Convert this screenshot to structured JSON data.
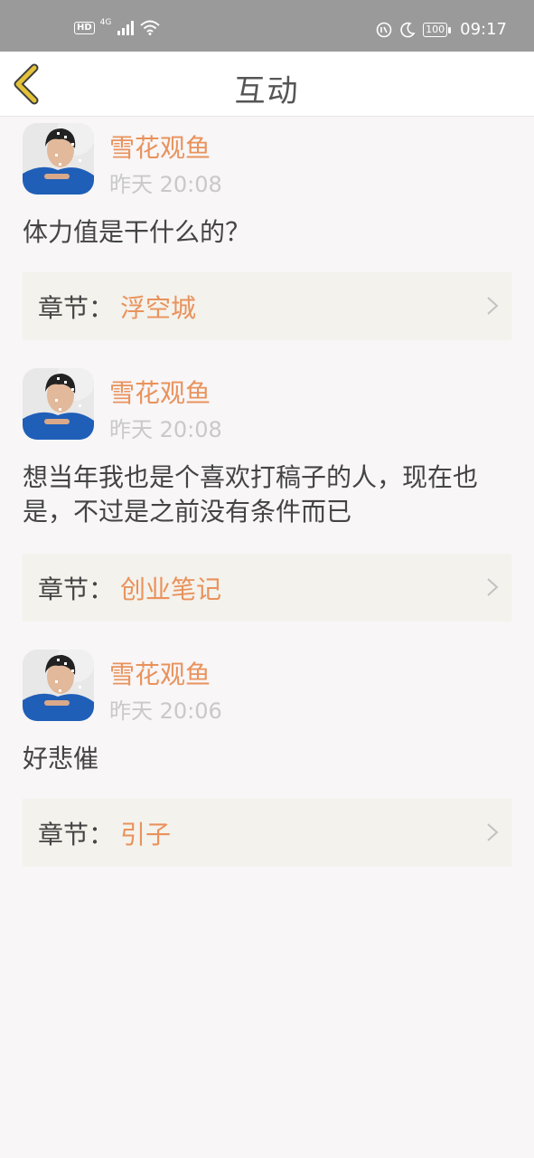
{
  "status_bar": {
    "hd": "HD",
    "network": "4G",
    "battery": "100",
    "time": "09:17"
  },
  "header": {
    "title": "互动"
  },
  "items": [
    {
      "username": "雪花观鱼",
      "time": "昨天 20:08",
      "content": "体力值是干什么的？",
      "chapter_prefix": "章节：",
      "chapter_name": "浮空城"
    },
    {
      "username": "雪花观鱼",
      "time": "昨天 20:08",
      "content": "想当年我也是个喜欢打稿子的人，现在也是，不过是之前没有条件而已",
      "chapter_prefix": "章节：",
      "chapter_name": "创业笔记"
    },
    {
      "username": "雪花观鱼",
      "time": "昨天 20:06",
      "content": "好悲催",
      "chapter_prefix": "章节：",
      "chapter_name": "引子"
    }
  ],
  "colors": {
    "accent": "#e9925c",
    "status_bar": "#9a9a9a",
    "background": "#f8f6f7",
    "chapter_bg": "#f4f2ec",
    "back_arrow": "#e3c23a"
  }
}
